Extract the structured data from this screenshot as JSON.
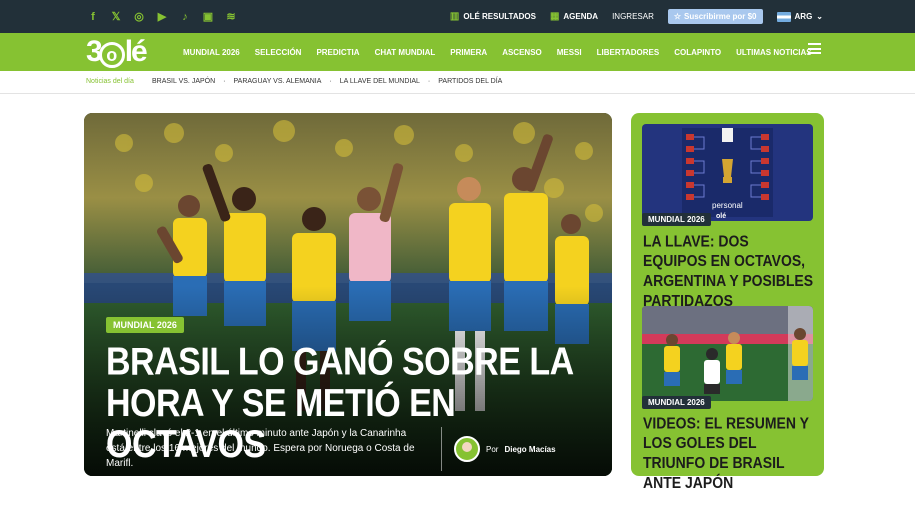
{
  "topbar": {
    "social_icons": [
      "facebook-icon",
      "x-icon",
      "instagram-icon",
      "youtube-icon",
      "tiktok-icon",
      "twitch-icon",
      "spotify-icon"
    ],
    "ole_resultados": "OLÉ RESULTADOS",
    "agenda": "AGENDA",
    "ingresar": "INGRESAR",
    "subscribe": "Suscribirme por $0",
    "country": "ARG"
  },
  "nav": {
    "logo": "30lé",
    "items": [
      "MUNDIAL 2026",
      "SELECCIÓN",
      "PREDICTIA",
      "CHAT MUNDIAL",
      "PRIMERA",
      "ASCENSO",
      "MESSI",
      "LIBERTADORES",
      "COLAPINTO",
      "ULTIMAS NOTICIAS"
    ]
  },
  "subnav": {
    "label": "Noticias del día",
    "links": [
      "BRASIL VS. JAPÓN",
      "PARAGUAY VS. ALEMANIA",
      "LA LLAVE DEL MUNDIAL",
      "PARTIDOS DEL DÍA"
    ]
  },
  "main_story": {
    "badge": "MUNDIAL 2026",
    "headline": "BRASIL LO GANÓ SOBRE LA HORA Y SE METIÓ EN OCTAVOS",
    "summary": "Martinelli clavó el 2-1 en el último minuto ante Japón y la Canarinha está entre los 16 mejores del mundo. Espera por Noruega o Costa de Marifl.",
    "author_prefix": "Por",
    "author": "Diego Macías"
  },
  "side_stories": [
    {
      "badge": "MUNDIAL 2026",
      "title": "LA LLAVE: DOS EQUIPOS EN OCTAVOS, ARGENTINA Y POSIBLES PARTIDAZOS",
      "thumb_text": "personal"
    },
    {
      "badge": "MUNDIAL 2026",
      "title": "VIDEOS: EL RESUMEN Y LOS GOLES DEL TRIUNFO DE BRASIL ANTE JAPÓN"
    }
  ],
  "colors": {
    "brand_green": "#86c232",
    "topbar_bg": "#223039",
    "brazil_yellow": "#f4d21f",
    "brazil_blue": "#2a6db5"
  }
}
